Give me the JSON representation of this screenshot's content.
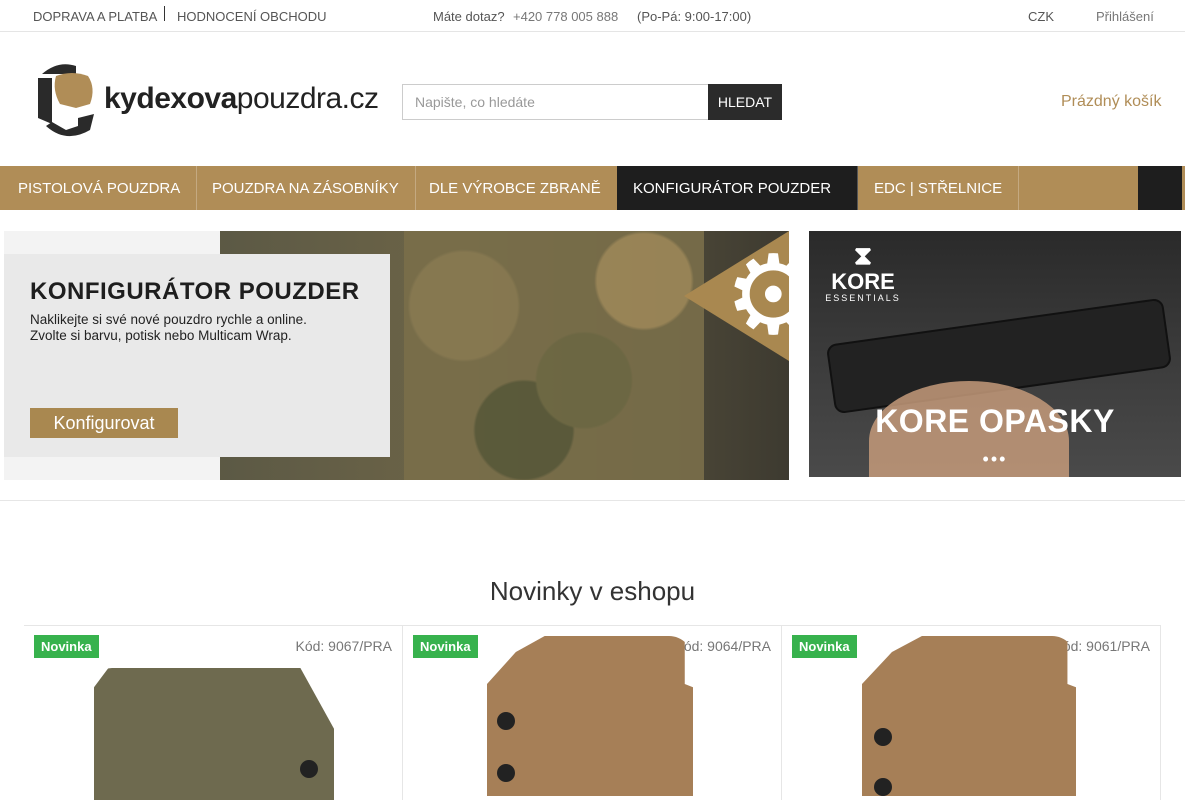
{
  "topbar": {
    "link1": "DOPRAVA A PLATBA",
    "link2": "HODNOCENÍ OBCHODU",
    "more_icon": "",
    "question": "Máte dotaz?",
    "phone": "+420 778 005 888",
    "hours": "(Po-Pá: 9:00-17:00)",
    "currency": "CZK",
    "currency_icon": "",
    "login": "Přihlášení"
  },
  "header": {
    "logo_bold": "kydexova",
    "logo_light": "pouzdra.cz",
    "search_placeholder": "Napište, co hledáte",
    "search_button": "HLEDAT",
    "cart_label": "Prázdný košík",
    "icon_user": "",
    "icon_cart": ""
  },
  "nav": {
    "items": [
      "PISTOLOVÁ POUZDRA",
      "POUZDRA NA ZÁSOBNÍKY",
      "DLE VÝROBCE ZBRANĚ",
      " KONFIGURÁTOR POUZDER",
      "EDC | STŘELNICE"
    ],
    "menu_icon": ""
  },
  "banner_main": {
    "title": "KONFIGURÁTOR POUZDER",
    "sub1": "Naklikejte si své nové pouzdro rychle a online.",
    "sub2": "Zvolte si barvu, potisk nebo Multicam Wrap.",
    "cta": "Konfigurovat"
  },
  "banner_side": {
    "brand": "KORE",
    "brand_sub": "ESSENTIALS",
    "headline": "KORE OPASKY",
    "dots": "•••"
  },
  "section": {
    "title": "Novinky v eshopu"
  },
  "products": [
    {
      "badge": "Novinka",
      "code": "Kód: 9067/PRA",
      "wish_icon": "",
      "color": "#6e6a4f"
    },
    {
      "badge": "Novinka",
      "code": "Kód: 9064/PRA",
      "wish_icon": "",
      "color": "#a67f57"
    },
    {
      "badge": "Novinka",
      "code": "Kód: 9061/PRA",
      "wish_icon": "",
      "color": "#a67f57"
    }
  ]
}
